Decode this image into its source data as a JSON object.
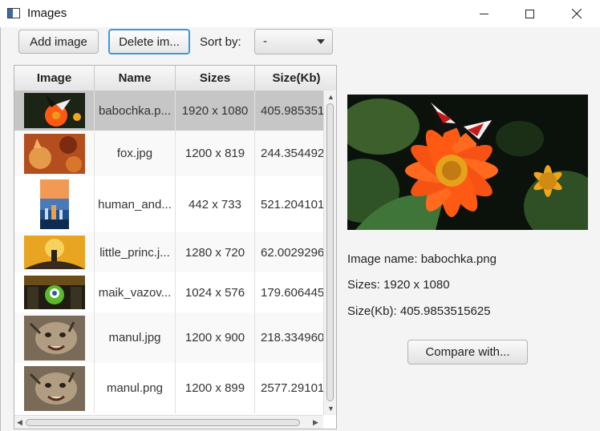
{
  "window": {
    "title": "Images"
  },
  "toolbar": {
    "add_label": "Add image",
    "delete_label": "Delete im...",
    "sort_label": "Sort by:",
    "sort_value": "-"
  },
  "table": {
    "headers": [
      "Image",
      "Name",
      "Sizes",
      "Size(Kb)"
    ],
    "rows": [
      {
        "name": "babochka.p...",
        "sizes": "1920 x 1080",
        "size_kb": "405.985351",
        "thumb": "butterfly"
      },
      {
        "name": "fox.jpg",
        "sizes": "1200 x 819",
        "size_kb": "244.354492",
        "thumb": "fox"
      },
      {
        "name": "human_and...",
        "sizes": "442 x 733",
        "size_kb": "521.204101",
        "thumb": "city-night"
      },
      {
        "name": "little_princ.j...",
        "sizes": "1280 x 720",
        "size_kb": "62.0029296",
        "thumb": "little-prince"
      },
      {
        "name": "maik_vazov...",
        "sizes": "1024 x 576",
        "size_kb": "179.606445",
        "thumb": "monster"
      },
      {
        "name": "manul.jpg",
        "sizes": "1200 x 900",
        "size_kb": "218.334960",
        "thumb": "manul"
      },
      {
        "name": "manul.png",
        "sizes": "1200 x 899",
        "size_kb": "2577.29101",
        "thumb": "manul"
      }
    ],
    "selected_index": 0
  },
  "details": {
    "name_line": "Image name: babochka.png",
    "sizes_line": "Sizes: 1920 x 1080",
    "size_kb_line": "Size(Kb): 405.9853515625",
    "compare_label": "Compare with..."
  },
  "colors": {
    "focus": "#3a9ad8",
    "selected_row": "#c6c6c6"
  }
}
